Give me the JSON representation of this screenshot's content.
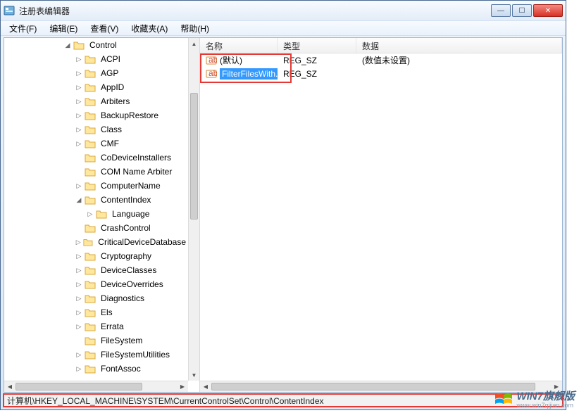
{
  "window": {
    "title": "注册表编辑器"
  },
  "menubar": [
    {
      "label": "文件(F)"
    },
    {
      "label": "编辑(E)"
    },
    {
      "label": "查看(V)"
    },
    {
      "label": "收藏夹(A)"
    },
    {
      "label": "帮助(H)"
    }
  ],
  "tree": {
    "root": "Control",
    "children": [
      {
        "label": "ACPI",
        "expandable": true
      },
      {
        "label": "AGP",
        "expandable": true
      },
      {
        "label": "AppID",
        "expandable": true
      },
      {
        "label": "Arbiters",
        "expandable": true
      },
      {
        "label": "BackupRestore",
        "expandable": true
      },
      {
        "label": "Class",
        "expandable": true
      },
      {
        "label": "CMF",
        "expandable": true
      },
      {
        "label": "CoDeviceInstallers",
        "expandable": false
      },
      {
        "label": "COM Name Arbiter",
        "expandable": false
      },
      {
        "label": "ComputerName",
        "expandable": true
      },
      {
        "label": "ContentIndex",
        "expandable": true,
        "expanded": true,
        "selected": true,
        "children": [
          {
            "label": "Language",
            "expandable": true
          }
        ]
      },
      {
        "label": "CrashControl",
        "expandable": false
      },
      {
        "label": "CriticalDeviceDatabase",
        "expandable": true
      },
      {
        "label": "Cryptography",
        "expandable": true
      },
      {
        "label": "DeviceClasses",
        "expandable": true
      },
      {
        "label": "DeviceOverrides",
        "expandable": true
      },
      {
        "label": "Diagnostics",
        "expandable": true
      },
      {
        "label": "Els",
        "expandable": true
      },
      {
        "label": "Errata",
        "expandable": true
      },
      {
        "label": "FileSystem",
        "expandable": false
      },
      {
        "label": "FileSystemUtilities",
        "expandable": true
      },
      {
        "label": "FontAssoc",
        "expandable": true
      }
    ]
  },
  "list": {
    "columns": {
      "name": "名称",
      "type": "类型",
      "data": "数据"
    },
    "rows": [
      {
        "name": "(默认)",
        "type": "REG_SZ",
        "data": "(数值未设置)",
        "selected": false
      },
      {
        "name": "FilterFilesWith...",
        "type": "REG_SZ",
        "data": "",
        "selected": true
      }
    ]
  },
  "statusbar": "计算机\\HKEY_LOCAL_MACHINE\\SYSTEM\\CurrentControlSet\\Control\\ContentIndex",
  "watermark": {
    "title": "WIN7旗舰版",
    "sub": "www.win7qijian.com"
  }
}
